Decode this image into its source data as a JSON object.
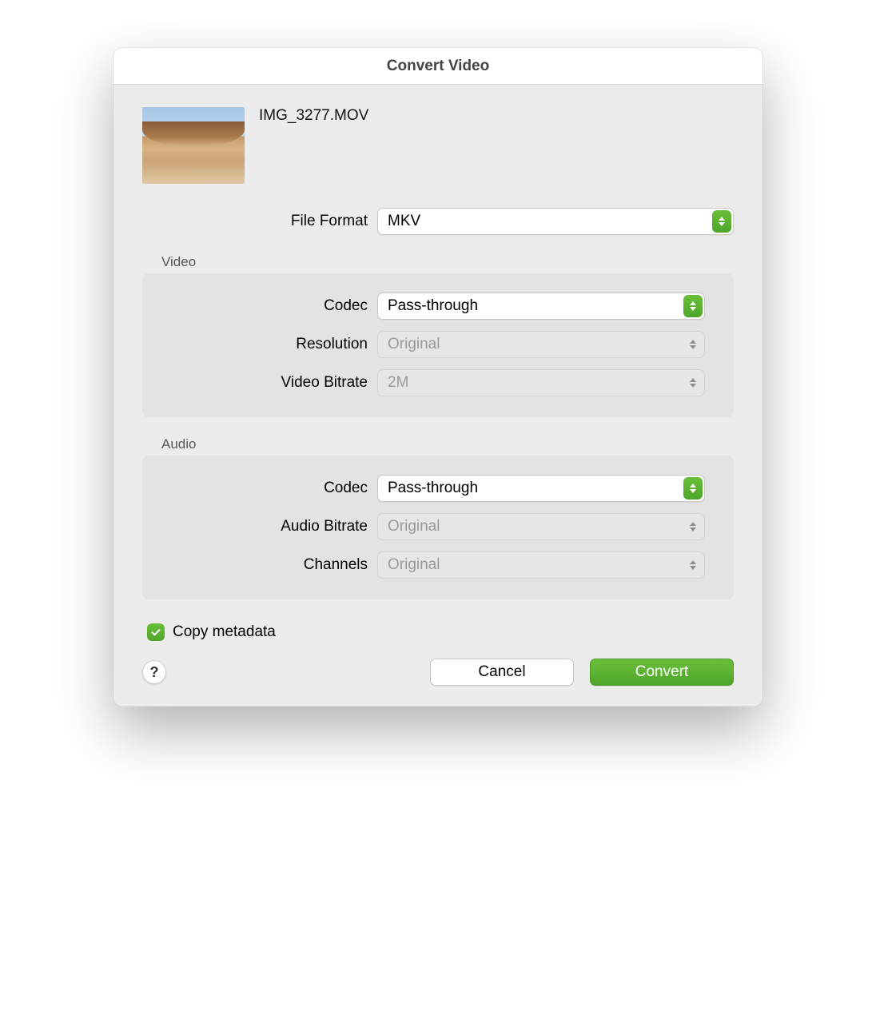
{
  "title": "Convert Video",
  "filename": "IMG_3277.MOV",
  "file_format": {
    "label": "File Format",
    "value": "MKV"
  },
  "video": {
    "section_label": "Video",
    "codec": {
      "label": "Codec",
      "value": "Pass-through",
      "enabled": true
    },
    "resolution": {
      "label": "Resolution",
      "value": "Original",
      "enabled": false
    },
    "bitrate": {
      "label": "Video Bitrate",
      "value": "2M",
      "enabled": false
    }
  },
  "audio": {
    "section_label": "Audio",
    "codec": {
      "label": "Codec",
      "value": "Pass-through",
      "enabled": true
    },
    "bitrate": {
      "label": "Audio Bitrate",
      "value": "Original",
      "enabled": false
    },
    "channels": {
      "label": "Channels",
      "value": "Original",
      "enabled": false
    }
  },
  "copy_metadata": {
    "label": "Copy metadata",
    "checked": true
  },
  "buttons": {
    "help": "?",
    "cancel": "Cancel",
    "convert": "Convert"
  }
}
